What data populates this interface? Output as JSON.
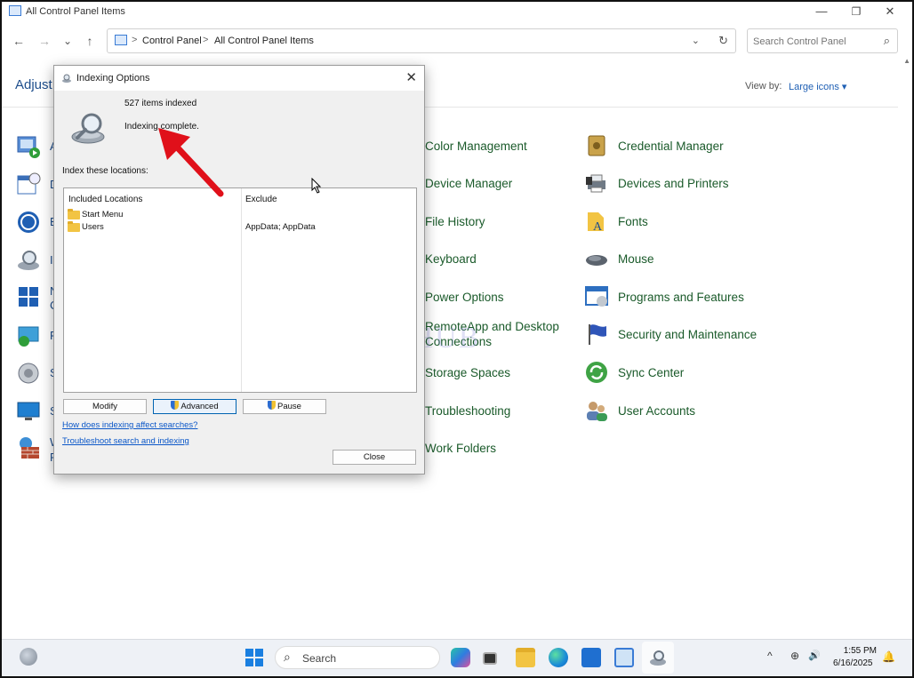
{
  "window": {
    "title": "All Control Panel Items",
    "minimize": "—",
    "restore": "❐",
    "close": "✕"
  },
  "nav": {
    "back": "←",
    "forward": "→",
    "recent": "⌄",
    "up": "↑",
    "breadcrumb": [
      "Control Panel",
      "All Control Panel Items"
    ],
    "separator": ">",
    "dropdown": "⌄",
    "refresh": "↻",
    "search_placeholder": "Search Control Panel",
    "search_icon": "⌕"
  },
  "header": {
    "adjust": "Adjust y",
    "view_by_label": "View by:",
    "view_by_value": "Large icons ▾"
  },
  "left_column_letters": [
    "A",
    "D",
    "E",
    "I",
    "N",
    "F",
    "S",
    "S",
    "W"
  ],
  "left_column_letters2": [
    "C",
    "F"
  ],
  "items": [
    {
      "label": "Color Management",
      "icon": "color-management-icon"
    },
    {
      "label": "Credential Manager",
      "icon": "credential-manager-icon"
    },
    {
      "label": "Device Manager",
      "icon": "device-manager-icon"
    },
    {
      "label": "Devices and Printers",
      "icon": "devices-printers-icon"
    },
    {
      "label": "File History",
      "icon": "file-history-icon"
    },
    {
      "label": "Fonts",
      "icon": "fonts-icon"
    },
    {
      "label": "Keyboard",
      "icon": "keyboard-icon"
    },
    {
      "label": "Mouse",
      "icon": "mouse-icon"
    },
    {
      "label": "Power Options",
      "icon": "power-options-icon"
    },
    {
      "label": "Programs and Features",
      "icon": "programs-features-icon"
    },
    {
      "label": "RemoteApp and Desktop",
      "label2": "Connections",
      "icon": "remoteapp-icon"
    },
    {
      "label": "Security and Maintenance",
      "icon": "security-maintenance-icon"
    },
    {
      "label": "Storage Spaces",
      "icon": "storage-spaces-icon"
    },
    {
      "label": "Sync Center",
      "icon": "sync-center-icon"
    },
    {
      "label": "Troubleshooting",
      "icon": "troubleshooting-icon"
    },
    {
      "label": "User Accounts",
      "icon": "user-accounts-icon"
    },
    {
      "label": "Work Folders",
      "icon": "work-folders-icon"
    }
  ],
  "dialog": {
    "title": "Indexing Options",
    "close": "✕",
    "items_indexed": "527 items indexed",
    "status": "Indexing complete.",
    "locations_label": "Index these locations:",
    "col_included": "Included Locations",
    "col_exclude": "Exclude",
    "locations": [
      {
        "name": "Start Menu",
        "exclude": ""
      },
      {
        "name": "Users",
        "exclude": "AppData; AppData"
      }
    ],
    "btn_modify": "Modify",
    "btn_advanced": "Advanced",
    "btn_pause": "Pause",
    "link_affect": "How does indexing affect searches?",
    "link_troubleshoot": "Troubleshoot search and indexing",
    "btn_close": "Close"
  },
  "watermark": "IT P...HUB",
  "taskbar": {
    "search_label": "Search",
    "search_icon": "⌕",
    "tray_chevron": "^",
    "tray_network": "⊕",
    "tray_speaker": "🔊",
    "time": "1:55 PM",
    "date": "6/16/2025",
    "bell": "🔔"
  }
}
